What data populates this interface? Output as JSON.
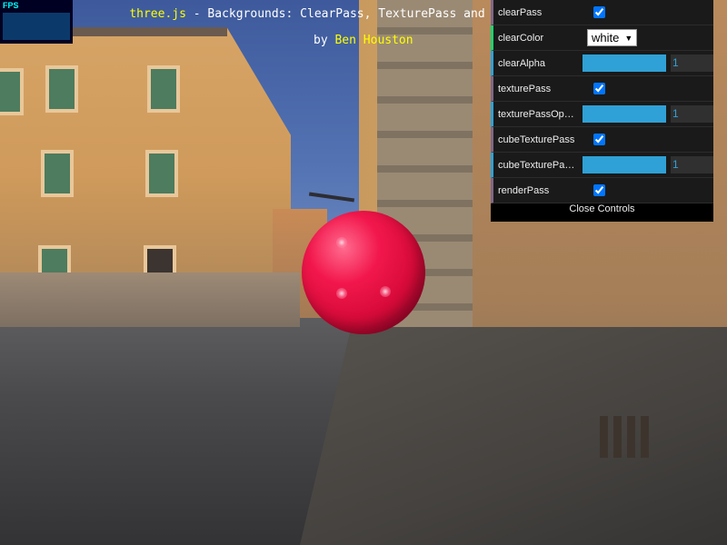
{
  "stats": {
    "label": "FPS"
  },
  "info": {
    "link_text": "three.js",
    "line1_rest": " - Backgrounds: ClearPass, TexturePass and",
    "by_prefix": "by ",
    "author": "Ben Houston"
  },
  "gui": {
    "controls": [
      {
        "label": "clearPass",
        "type": "boolean",
        "checked": true
      },
      {
        "label": "clearColor",
        "type": "select",
        "value": "white"
      },
      {
        "label": "clearAlpha",
        "type": "number",
        "value": "1",
        "fraction": 1
      },
      {
        "label": "texturePass",
        "type": "boolean",
        "checked": true
      },
      {
        "label": "texturePassOpa…",
        "type": "number",
        "value": "1",
        "fraction": 1
      },
      {
        "label": "cubeTexturePass",
        "type": "boolean",
        "checked": true
      },
      {
        "label": "cubeTexturePas…",
        "type": "number",
        "value": "1",
        "fraction": 1
      },
      {
        "label": "renderPass",
        "type": "boolean",
        "checked": true
      }
    ],
    "close_label": "Close Controls",
    "accent_colors": {
      "boolean": "#806787",
      "string": "#1ed36f",
      "number": "#2fa1d6"
    }
  }
}
